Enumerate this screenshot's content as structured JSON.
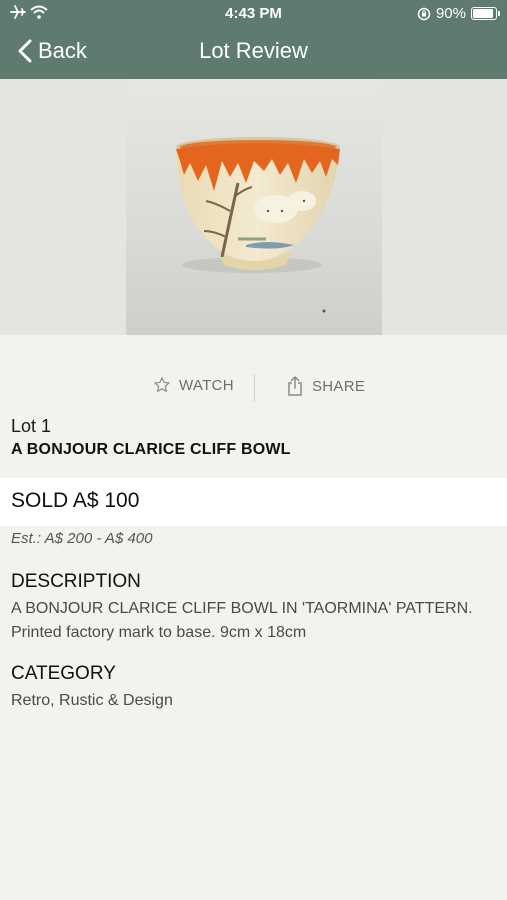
{
  "status": {
    "time": "4:43 PM",
    "battery": "90%",
    "battery_level": 0.9
  },
  "nav": {
    "back_label": "Back",
    "title": "Lot Review"
  },
  "actions": {
    "watch": "WATCH",
    "share": "SHARE"
  },
  "lot": {
    "number": "Lot 1",
    "title": "A BONJOUR CLARICE CLIFF BOWL",
    "sold": "SOLD A$ 100",
    "estimate": "Est.: A$ 200 - A$ 400"
  },
  "description": {
    "heading": "DESCRIPTION",
    "text": "A BONJOUR CLARICE CLIFF BOWL IN 'TAORMINA' PATTERN. Printed factory mark to base. 9cm x 18cm"
  },
  "category": {
    "heading": "CATEGORY",
    "text": "Retro, Rustic & Design"
  },
  "colors": {
    "header": "#5f7a6e",
    "background": "#f3f2ee"
  }
}
